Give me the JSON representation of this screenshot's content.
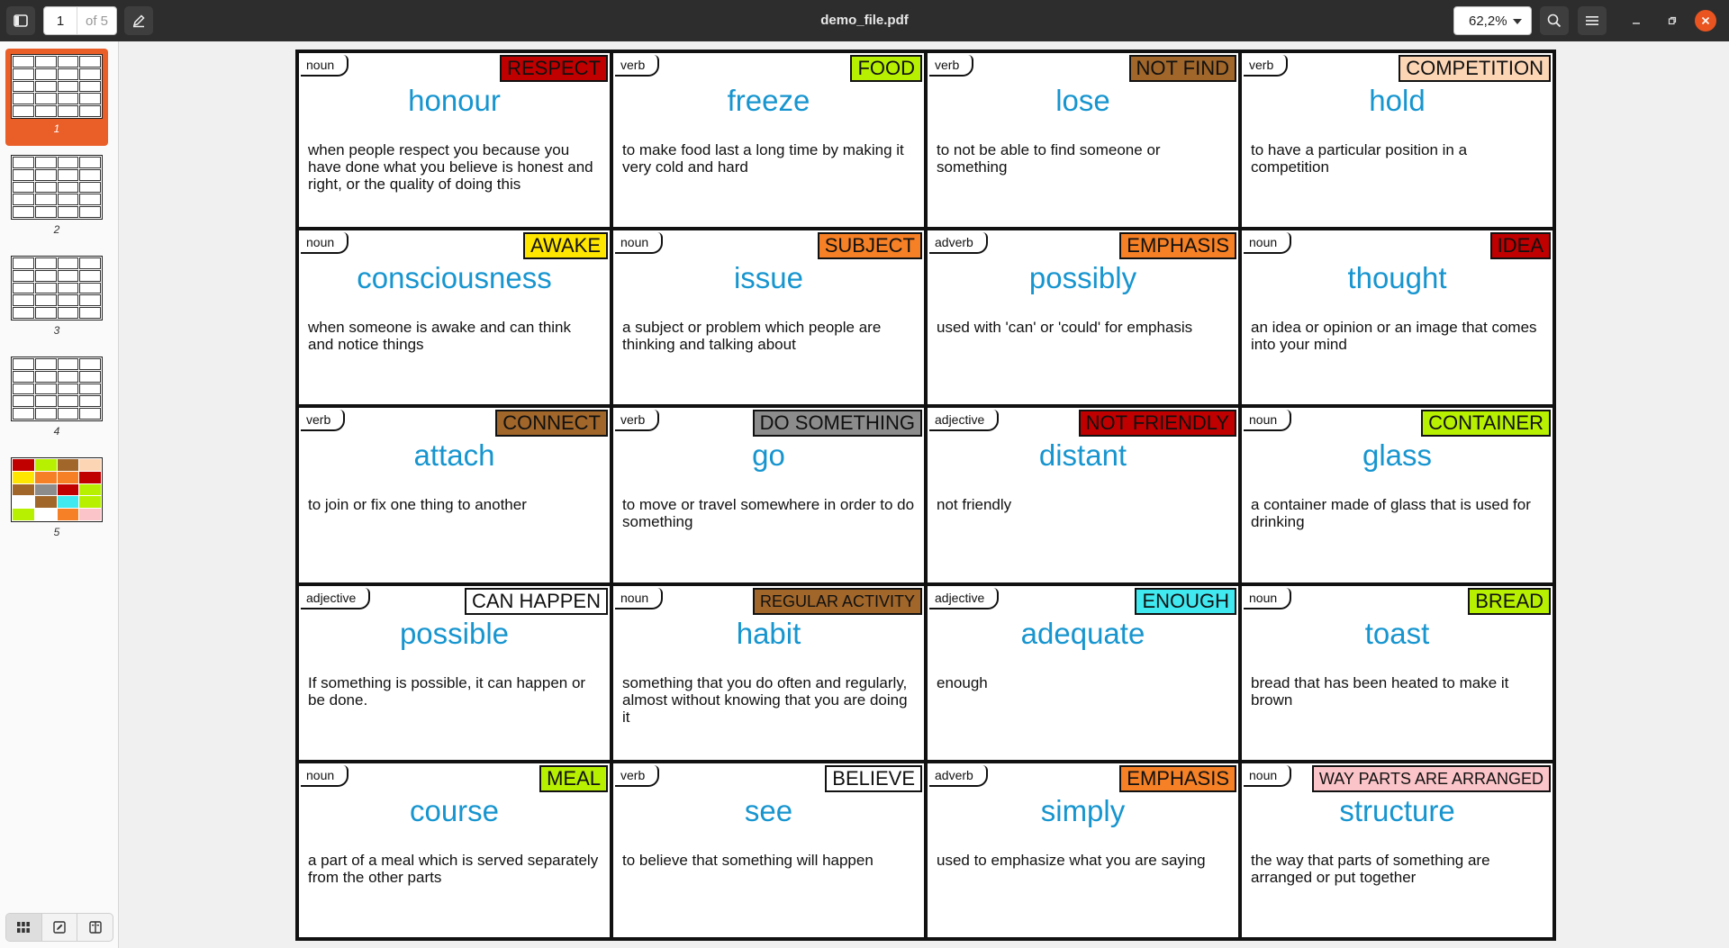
{
  "toolbar": {
    "current_page": "1",
    "page_total": "of 5",
    "title": "demo_file.pdf",
    "zoom": "62,2%"
  },
  "sidebar": {
    "thumbnails": [
      {
        "label": "1",
        "selected": true
      },
      {
        "label": "2",
        "selected": false
      },
      {
        "label": "3",
        "selected": false
      },
      {
        "label": "4",
        "selected": false
      },
      {
        "label": "5",
        "selected": false
      }
    ]
  },
  "cards": [
    {
      "pos": "noun",
      "tag": "RESPECT",
      "tag_bg": "#c00000",
      "word": "honour",
      "def": "when people respect you because you have done what you believe is honest and right, or the quality of doing this"
    },
    {
      "pos": "verb",
      "tag": "FOOD",
      "tag_bg": "#b7f000",
      "word": "freeze",
      "def": "to make food last a long time by making it very cold and hard"
    },
    {
      "pos": "verb",
      "tag": "NOT FIND",
      "tag_bg": "#a0662a",
      "word": "lose",
      "def": "to not be able to find someone or something"
    },
    {
      "pos": "verb",
      "tag": "COMPETITION",
      "tag_bg": "#fcd5b5",
      "word": "hold",
      "def": "to have a particular position in a competition"
    },
    {
      "pos": "noun",
      "tag": "AWAKE",
      "tag_bg": "#ffe600",
      "word": "consciousness",
      "def": "when someone is awake and can think and notice things"
    },
    {
      "pos": "noun",
      "tag": "SUBJECT",
      "tag_bg": "#f58025",
      "word": "issue",
      "def": "a subject or problem which people are thinking and talking about"
    },
    {
      "pos": "adverb",
      "tag": "EMPHASIS",
      "tag_bg": "#f58025",
      "word": "possibly",
      "def": "used with 'can' or 'could' for emphasis"
    },
    {
      "pos": "noun",
      "tag": "IDEA",
      "tag_bg": "#c00000",
      "word": "thought",
      "def": "an idea or opinion or an image that comes into your mind"
    },
    {
      "pos": "verb",
      "tag": "CONNECT",
      "tag_bg": "#a0662a",
      "word": "attach",
      "def": "to join or fix one thing to another"
    },
    {
      "pos": "verb",
      "tag": "DO SOMETHING",
      "tag_bg": "#8c8c8c",
      "word": "go",
      "def": "to move or travel somewhere in order to do something"
    },
    {
      "pos": "adjective",
      "tag": "NOT FRIENDLY",
      "tag_bg": "#c00000",
      "word": "distant",
      "def": "not friendly"
    },
    {
      "pos": "noun",
      "tag": "CONTAINER",
      "tag_bg": "#b7f000",
      "word": "glass",
      "def": "a container made of glass that is used for drinking"
    },
    {
      "pos": "adjective",
      "tag": "CAN HAPPEN",
      "tag_bg": "#ffffff",
      "word": "possible",
      "def": "If something is possible, it can happen or be done."
    },
    {
      "pos": "noun",
      "tag": "REGULAR ACTIVITY",
      "tag_bg": "#a0662a",
      "word": "habit",
      "def": "something that you do often and regularly, almost without knowing that you are doing it"
    },
    {
      "pos": "adjective",
      "tag": "ENOUGH",
      "tag_bg": "#40e8f0",
      "word": "adequate",
      "def": "enough"
    },
    {
      "pos": "noun",
      "tag": "BREAD",
      "tag_bg": "#b7f000",
      "word": "toast",
      "def": "bread that has been heated to make it brown"
    },
    {
      "pos": "noun",
      "tag": "MEAL",
      "tag_bg": "#b7f000",
      "word": "course",
      "def": "a part of a meal which is served separately from the other parts"
    },
    {
      "pos": "verb",
      "tag": "BELIEVE",
      "tag_bg": "#ffffff",
      "word": "see",
      "def": "to believe that something will happen"
    },
    {
      "pos": "adverb",
      "tag": "EMPHASIS",
      "tag_bg": "#f58025",
      "word": "simply",
      "def": "used to emphasize what you are saying"
    },
    {
      "pos": "noun",
      "tag": "WAY PARTS ARE ARRANGED",
      "tag_bg": "#fbc4c8",
      "word": "structure",
      "def": "the way that parts of something are arranged or put together"
    }
  ],
  "colors": {
    "accent": "#ea5e28",
    "word_text": "#1795cf",
    "header_bg": "#2d2d2d"
  }
}
